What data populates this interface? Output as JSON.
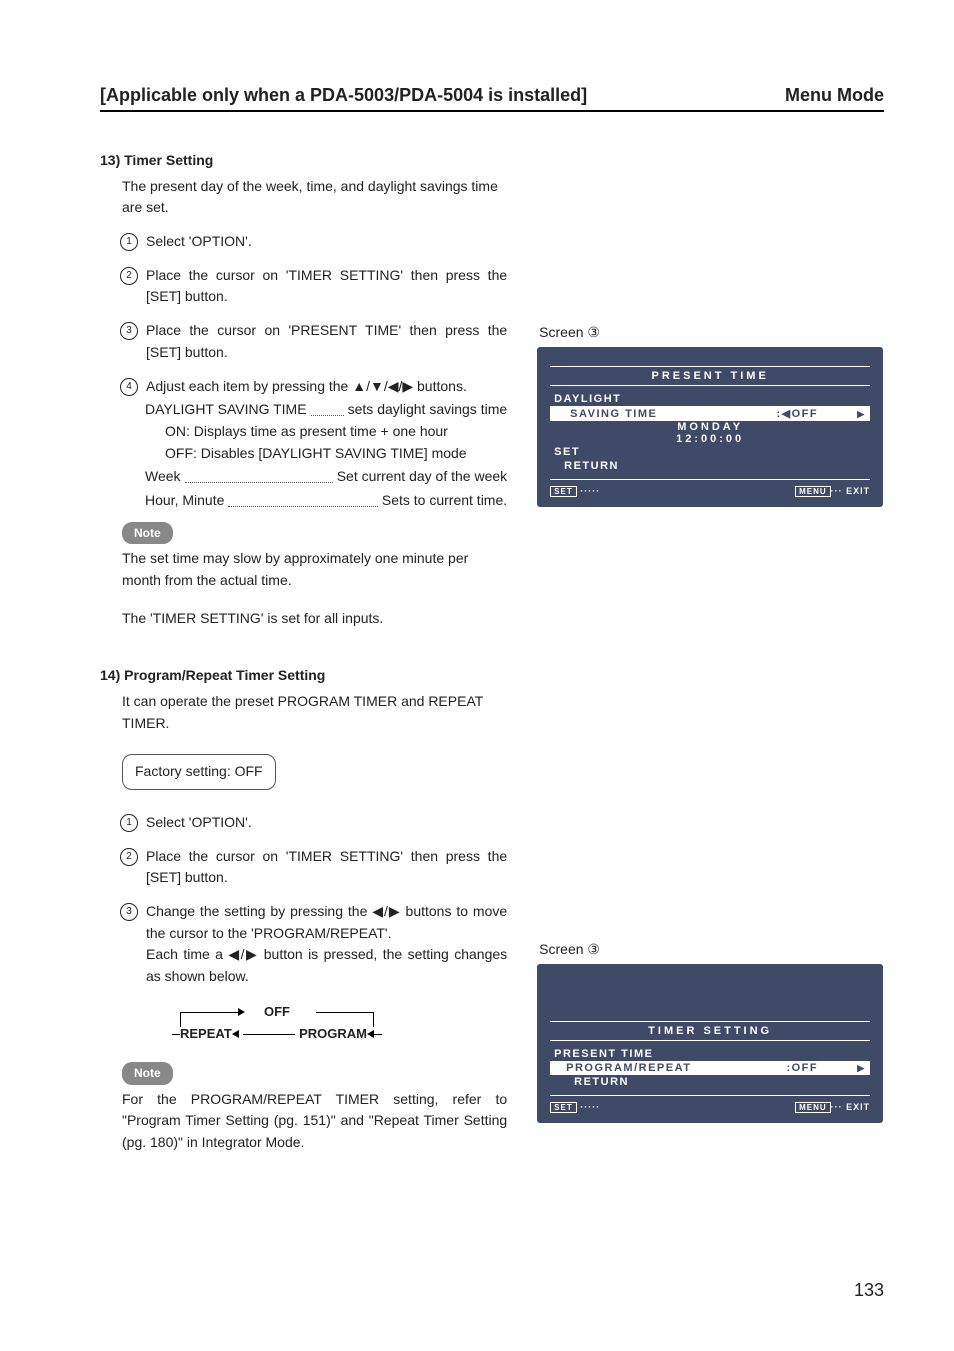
{
  "header": {
    "left": "[Applicable only when a PDA-5003/PDA-5004 is installed]",
    "right": "Menu Mode"
  },
  "section13": {
    "heading": "13) Timer Setting",
    "intro": "The present day of the week, time, and daylight savings time are set.",
    "steps": {
      "n1": "1",
      "s1": "Select 'OPTION'.",
      "n2": "2",
      "s2": "Place the cursor on 'TIMER SETTING' then press the [SET] button.",
      "n3": "3",
      "s3": "Place the cursor on 'PRESENT TIME' then press the [SET] button.",
      "n4": "4",
      "s4": "Adjust each item by pressing the ▲/▼/◀/▶ buttons."
    },
    "defs": {
      "dst_name": "DAYLIGHT SAVING TIME",
      "dst_val": "sets daylight savings time",
      "dst_on": "ON: Displays time as present time + one hour",
      "dst_off": "OFF: Disables [DAYLIGHT SAVING TIME] mode",
      "week_name": "Week",
      "week_val": "Set current day of the week",
      "hm_name": "Hour, Minute",
      "hm_val": "Sets to current time."
    },
    "note_label": "Note",
    "note_text": "The set time may slow by approximately one minute per month from the actual time.",
    "closing": "The 'TIMER SETTING' is set for all inputs."
  },
  "section14": {
    "heading": "14) Program/Repeat Timer Setting",
    "intro": "It can operate the preset PROGRAM TIMER and REPEAT TIMER.",
    "factory": "Factory setting: OFF",
    "steps": {
      "n1": "1",
      "s1": "Select 'OPTION'.",
      "n2": "2",
      "s2": "Place the cursor on 'TIMER SETTING' then press the [SET] button.",
      "n3": "3",
      "s3a": "Change the setting by pressing the ◀/▶ buttons to move the cursor to the 'PROGRAM/REPEAT'.",
      "s3b": "Each time a ◀/▶ button is pressed, the setting changes as shown below."
    },
    "cycle": {
      "off": "OFF",
      "repeat": "REPEAT",
      "program": "PROGRAM"
    },
    "note_label": "Note",
    "note_text": "For the PROGRAM/REPEAT TIMER setting, refer to \"Program Timer Setting (pg. 151)\" and \"Repeat Timer Setting (pg. 180)\" in Integrator Mode."
  },
  "osd1": {
    "caption": "Screen ③",
    "title": "PRESENT TIME",
    "row1a": "DAYLIGHT",
    "row1b": "SAVING TIME",
    "row1v": ":◀OFF",
    "day": "MONDAY",
    "time": "12:00:00",
    "set": "SET",
    "return": "RETURN",
    "foot_set": "SET",
    "foot_menu_k": "MENU",
    "foot_menu_v": "··· EXIT"
  },
  "osd2": {
    "caption": "Screen ③",
    "title": "TIMER SETTING",
    "r1": "PRESENT TIME",
    "r2": "PROGRAM/REPEAT",
    "r2v": ":OFF",
    "r3": "RETURN",
    "foot_set": "SET",
    "foot_menu_k": "MENU",
    "foot_menu_v": "··· EXIT"
  },
  "page_number": "133"
}
